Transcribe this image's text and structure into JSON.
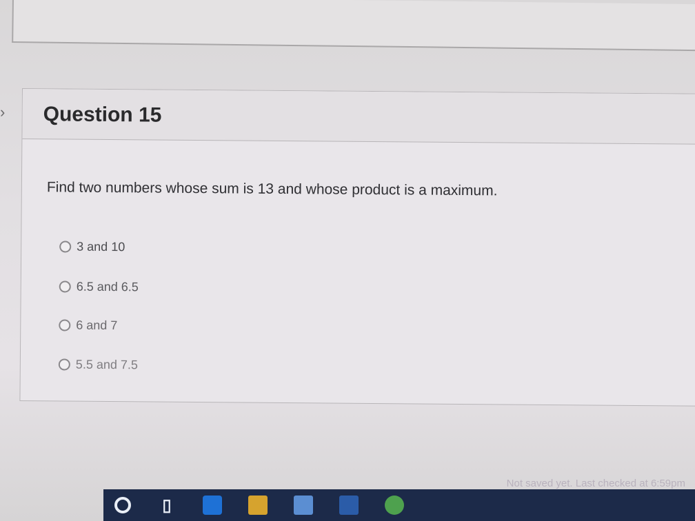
{
  "question": {
    "title": "Question 15",
    "text": "Find two numbers whose sum is 13 and whose product is a maximum.",
    "answers": [
      {
        "label": "3 and 10"
      },
      {
        "label": "6.5 and 6.5"
      },
      {
        "label": "6 and 7"
      },
      {
        "label": "5.5 and 7.5"
      }
    ]
  },
  "status": {
    "text": "Not saved yet. Last checked at 6:59pm"
  },
  "taskbar": {
    "icons": [
      "search-icon",
      "task-view-icon",
      "edge-icon",
      "file-explorer-icon",
      "store-icon",
      "word-icon",
      "chrome-icon"
    ]
  }
}
